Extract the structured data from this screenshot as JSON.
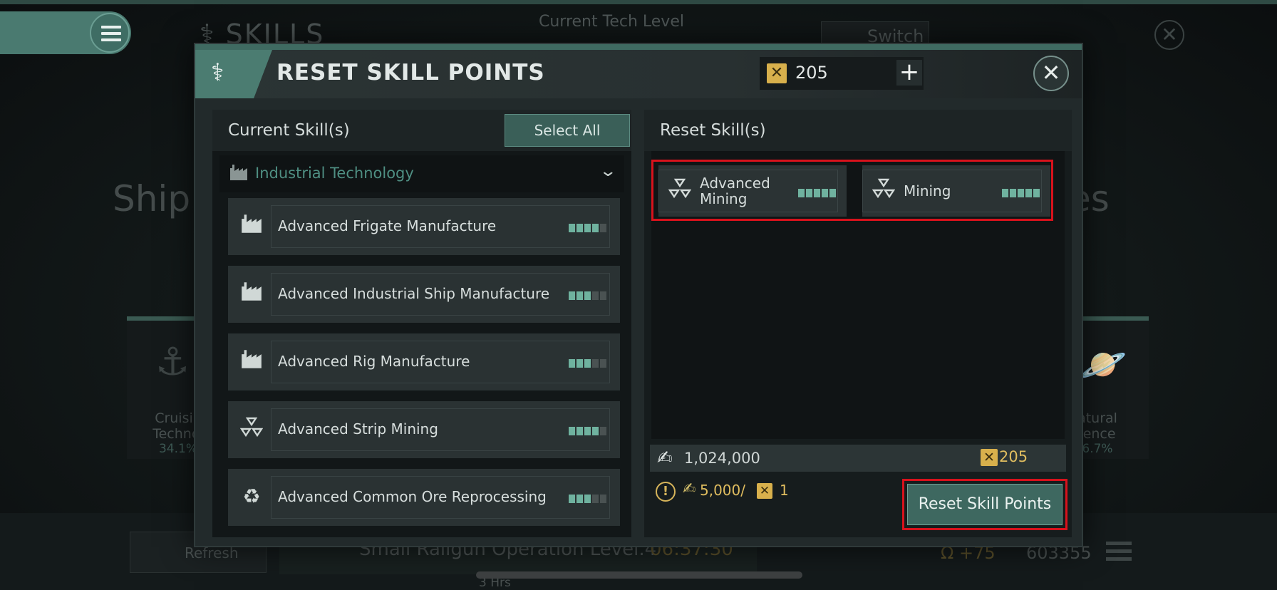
{
  "background": {
    "title": "SKILLS",
    "tech_level_label": "Current Tech Level",
    "switch_label": "Switch",
    "ship_partial": "Ship",
    "es_partial": "es",
    "cards": [
      {
        "label": "Cruisin\nTechnol",
        "percent": "34.1%"
      },
      {
        "label": "atural\nience",
        "percent": "6.7%"
      }
    ],
    "refresh_label": "Refresh",
    "queue_text": "Small Railgun Operation Level.4",
    "timer": "06:37:30",
    "hours": "3 Hrs",
    "bonus": "+75",
    "count": "603355"
  },
  "modal": {
    "title": "RESET SKILL POINTS",
    "currency_amount": "205",
    "currency_icon": "skill-token-icon",
    "accent_color": "#4b7c71",
    "highlight_color": "#d8121c"
  },
  "left_panel": {
    "header": "Current Skill(s)",
    "select_all": "Select All",
    "category": "Industrial Technology",
    "skills": [
      {
        "name": "Advanced Frigate Manufacture",
        "icon": "factory-icon",
        "level": 4,
        "max": 5
      },
      {
        "name": "Advanced Industrial Ship Manufacture",
        "icon": "factory-icon",
        "level": 3,
        "max": 5
      },
      {
        "name": "Advanced Rig Manufacture",
        "icon": "factory-icon",
        "level": 3,
        "max": 5
      },
      {
        "name": "Advanced Strip Mining",
        "icon": "mining-icon",
        "level": 4,
        "max": 5
      },
      {
        "name": "Advanced Common Ore Reprocessing",
        "icon": "recycle-icon",
        "level": 3,
        "max": 5
      }
    ]
  },
  "right_panel": {
    "header": "Reset Skill(s)",
    "selected": [
      {
        "name_line1": "Advanced",
        "name_line2": "Mining",
        "icon": "mining-icon",
        "level": 5,
        "max": 5
      },
      {
        "name_line1": "Mining",
        "name_line2": "",
        "icon": "mining-icon",
        "level": 5,
        "max": 5
      }
    ],
    "cost_isk": "1,024,000",
    "cost_tokens": "205",
    "rate_isk": "5,000/",
    "rate_tokens": "1",
    "reset_button": "Reset Skill Points"
  }
}
